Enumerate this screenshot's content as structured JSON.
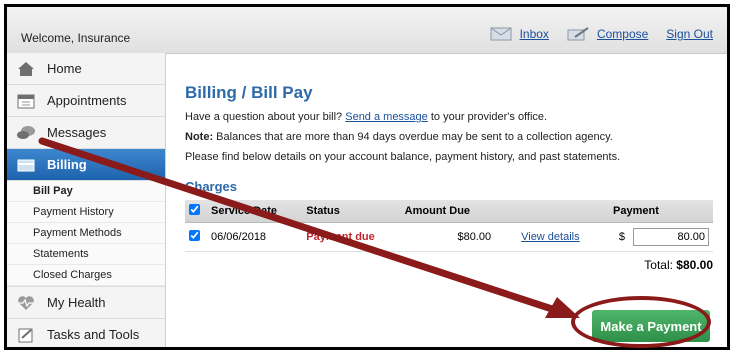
{
  "topbar": {
    "welcome": "Welcome, Insurance",
    "inbox_label": "Inbox",
    "compose_label": "Compose",
    "signout_label": "Sign Out"
  },
  "sidebar": {
    "items": [
      {
        "label": "Home",
        "icon": "home-icon"
      },
      {
        "label": "Appointments",
        "icon": "calendar-icon"
      },
      {
        "label": "Messages",
        "icon": "chat-icon"
      },
      {
        "label": "Billing",
        "icon": "billing-icon"
      },
      {
        "label": "My Health",
        "icon": "heart-icon"
      },
      {
        "label": "Tasks and Tools",
        "icon": "tasks-icon"
      }
    ],
    "billing_sub": [
      "Bill Pay",
      "Payment History",
      "Payment Methods",
      "Statements",
      "Closed Charges"
    ]
  },
  "main": {
    "title": "Billing / Bill Pay",
    "question_prefix": "Have a question about your bill?",
    "question_link": "Send a message",
    "question_suffix": "to your provider's office.",
    "note_label": "Note:",
    "note_text": "Balances that are more than 94 days overdue may be sent to a collection agency.",
    "info_text": "Please find below details on your account balance, payment history, and past statements.",
    "charges_title": "Charges",
    "columns": [
      "Service Date",
      "Status",
      "Amount Due",
      "",
      "Payment"
    ],
    "rows": [
      {
        "date": "06/06/2018",
        "status": "Payment due",
        "amount": "$80.00",
        "link": "View details",
        "currency": "$",
        "payment": "80.00"
      }
    ],
    "total_label": "Total:",
    "total_value": "$80.00",
    "pay_button": "Make a Payment"
  },
  "colors": {
    "accent": "#2d6aaa",
    "active_nav": "#1f63ad",
    "pay_button": "#2f8f48",
    "status_due": "#c0262d",
    "annotation": "#8b1a1a"
  }
}
